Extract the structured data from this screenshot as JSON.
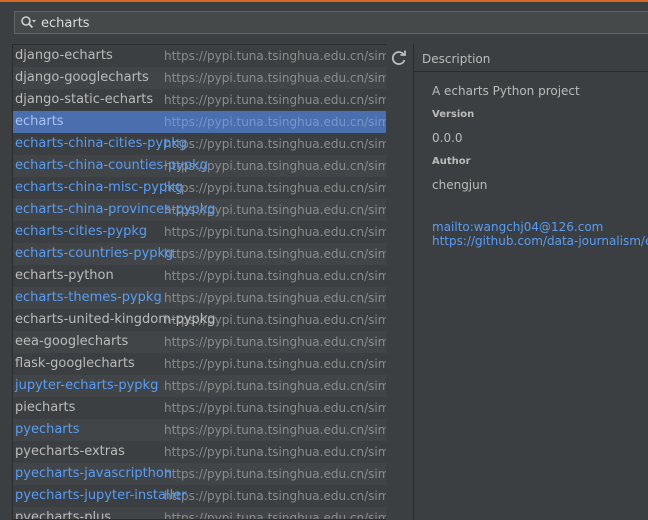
{
  "search": {
    "query": "echarts"
  },
  "packages": [
    {
      "name": "django-echarts",
      "repo": "https://pypi.tuna.tsinghua.edu.cn/simple/",
      "updated": false
    },
    {
      "name": "django-googlecharts",
      "repo": "https://pypi.tuna.tsinghua.edu.cn/simple/",
      "updated": false
    },
    {
      "name": "django-static-echarts",
      "repo": "https://pypi.tuna.tsinghua.edu.cn/simple/",
      "updated": false
    },
    {
      "name": "echarts",
      "repo": "https://pypi.tuna.tsinghua.edu.cn/simple/",
      "updated": true,
      "selected": true
    },
    {
      "name": "echarts-china-cities-pypkg",
      "repo": "https://pypi.tuna.tsinghua.edu.cn/simple/",
      "updated": true
    },
    {
      "name": "echarts-china-counties-pypkg",
      "repo": "https://pypi.tuna.tsinghua.edu.cn/simple/",
      "updated": true
    },
    {
      "name": "echarts-china-misc-pypkg",
      "repo": "https://pypi.tuna.tsinghua.edu.cn/simple/",
      "updated": true
    },
    {
      "name": "echarts-china-provinces-pypkg",
      "repo": "https://pypi.tuna.tsinghua.edu.cn/simple/",
      "updated": true
    },
    {
      "name": "echarts-cities-pypkg",
      "repo": "https://pypi.tuna.tsinghua.edu.cn/simple/",
      "updated": true
    },
    {
      "name": "echarts-countries-pypkg",
      "repo": "https://pypi.tuna.tsinghua.edu.cn/simple/",
      "updated": true
    },
    {
      "name": "echarts-python",
      "repo": "https://pypi.tuna.tsinghua.edu.cn/simple/",
      "updated": false
    },
    {
      "name": "echarts-themes-pypkg",
      "repo": "https://pypi.tuna.tsinghua.edu.cn/simple/",
      "updated": true
    },
    {
      "name": "echarts-united-kingdom-pypkg",
      "repo": "https://pypi.tuna.tsinghua.edu.cn/simple/",
      "updated": false
    },
    {
      "name": "eea-googlecharts",
      "repo": "https://pypi.tuna.tsinghua.edu.cn/simple/",
      "updated": false
    },
    {
      "name": "flask-googlecharts",
      "repo": "https://pypi.tuna.tsinghua.edu.cn/simple/",
      "updated": false
    },
    {
      "name": "jupyter-echarts-pypkg",
      "repo": "https://pypi.tuna.tsinghua.edu.cn/simple/",
      "updated": true
    },
    {
      "name": "piecharts",
      "repo": "https://pypi.tuna.tsinghua.edu.cn/simple/",
      "updated": false
    },
    {
      "name": "pyecharts",
      "repo": "https://pypi.tuna.tsinghua.edu.cn/simple/",
      "updated": true
    },
    {
      "name": "pyecharts-extras",
      "repo": "https://pypi.tuna.tsinghua.edu.cn/simple/",
      "updated": false
    },
    {
      "name": "pyecharts-javascripthon",
      "repo": "https://pypi.tuna.tsinghua.edu.cn/simple/",
      "updated": true
    },
    {
      "name": "pyecharts-jupyter-installer",
      "repo": "https://pypi.tuna.tsinghua.edu.cn/simple/",
      "updated": true
    },
    {
      "name": "pyecharts-plus",
      "repo": "https://pypi.tuna.tsinghua.edu.cn/simple/",
      "updated": false
    }
  ],
  "description": {
    "header": "Description",
    "summary": "A echarts Python project",
    "version_label": "Version",
    "version": "0.0.0",
    "author_label": "Author",
    "author": "chengjun",
    "email_link": "mailto:wangchj04@126.com",
    "home_link": "https://github.com/data-journalism/echarts-python"
  },
  "colors": {
    "accent": "#d4692a",
    "selection": "#4b6eaf",
    "link": "#589df6",
    "background": "#3c3f41"
  },
  "icons": {
    "search": "search-icon",
    "refresh": "refresh-icon"
  }
}
